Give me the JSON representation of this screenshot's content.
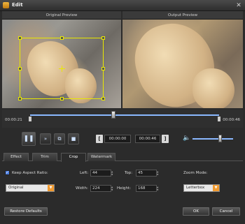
{
  "window": {
    "title": "Edit",
    "close_glyph": "✕"
  },
  "preview": {
    "original_label": "Original Preview",
    "output_label": "Output Preview"
  },
  "timeline": {
    "start_time": "00:00:21",
    "end_time": "00:00:46",
    "position_fraction": 0.58
  },
  "playback": {
    "play_pause_glyph": "❚❚",
    "fast_forward_glyph": "»",
    "frame_glyph": "⧉",
    "stop_glyph": "■",
    "set_start_glyph": "[",
    "start_time": "00:00:00",
    "set_end_glyph": "]",
    "end_time": "00:00:46",
    "volume_glyph": "🔈",
    "volume_fraction": 0.66
  },
  "tabs": [
    {
      "label": "Effect"
    },
    {
      "label": "Trim"
    },
    {
      "label": "Crop",
      "active": true
    },
    {
      "label": "Watermark"
    }
  ],
  "crop": {
    "keep_aspect_label": "Keep Aspect Ratio:",
    "keep_aspect_checked": "✓",
    "aspect_value": "Original",
    "left_label": "Left:",
    "left_value": "44",
    "top_label": "Top:",
    "top_value": "45",
    "width_label": "Width:",
    "width_value": "224",
    "height_label": "Height:",
    "height_value": "168",
    "zoom_mode_label": "Zoom Mode:",
    "zoom_mode_value": "Letterbox"
  },
  "footer": {
    "restore_label": "Restore Defaults",
    "ok_label": "OK",
    "cancel_label": "Cancel"
  },
  "colors": {
    "accent": "#8ab8ff",
    "crop_frame": "#e8e800",
    "dropdown_arrow": "#f09a30"
  }
}
